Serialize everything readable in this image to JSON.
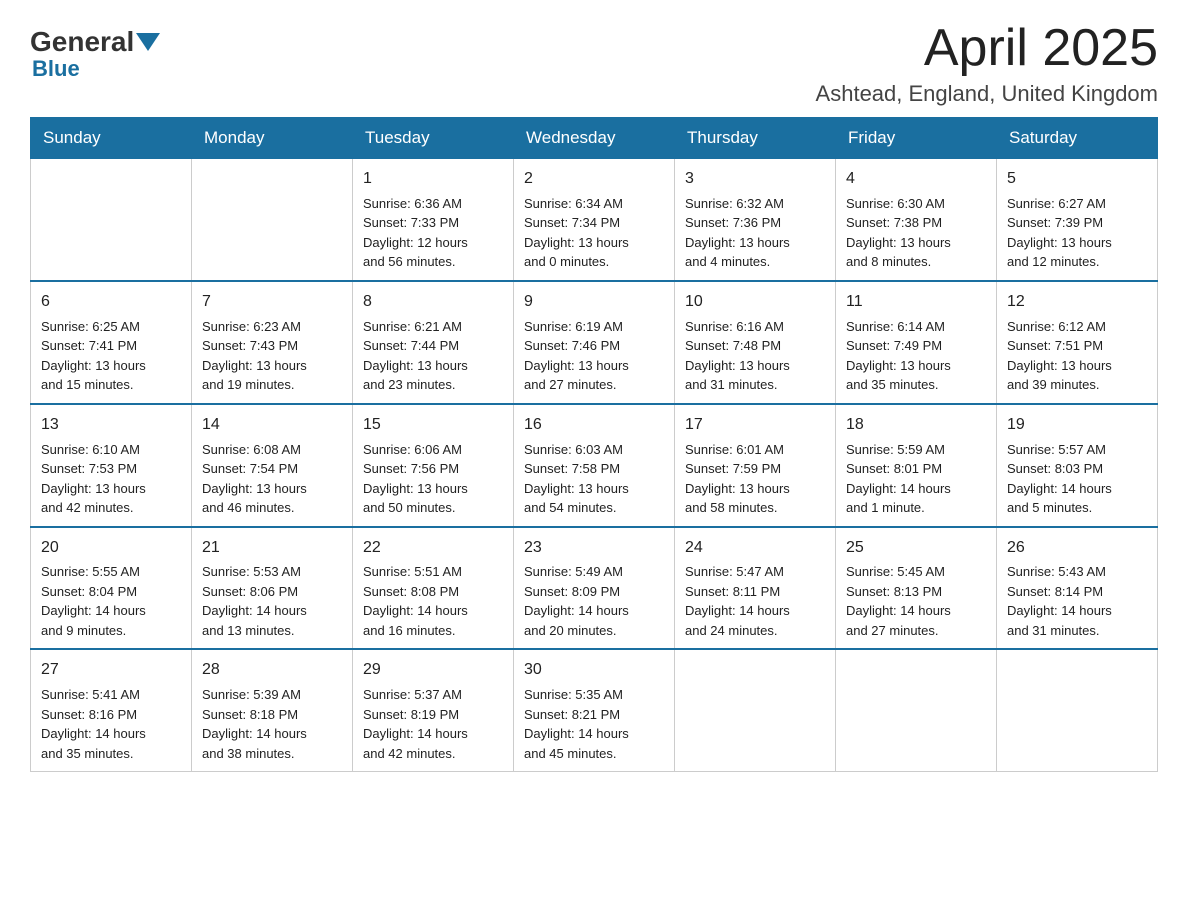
{
  "logo": {
    "general": "General",
    "blue": "Blue"
  },
  "title": "April 2025",
  "subtitle": "Ashtead, England, United Kingdom",
  "weekdays": [
    "Sunday",
    "Monday",
    "Tuesday",
    "Wednesday",
    "Thursday",
    "Friday",
    "Saturday"
  ],
  "weeks": [
    [
      {
        "day": "",
        "info": ""
      },
      {
        "day": "",
        "info": ""
      },
      {
        "day": "1",
        "info": "Sunrise: 6:36 AM\nSunset: 7:33 PM\nDaylight: 12 hours\nand 56 minutes."
      },
      {
        "day": "2",
        "info": "Sunrise: 6:34 AM\nSunset: 7:34 PM\nDaylight: 13 hours\nand 0 minutes."
      },
      {
        "day": "3",
        "info": "Sunrise: 6:32 AM\nSunset: 7:36 PM\nDaylight: 13 hours\nand 4 minutes."
      },
      {
        "day": "4",
        "info": "Sunrise: 6:30 AM\nSunset: 7:38 PM\nDaylight: 13 hours\nand 8 minutes."
      },
      {
        "day": "5",
        "info": "Sunrise: 6:27 AM\nSunset: 7:39 PM\nDaylight: 13 hours\nand 12 minutes."
      }
    ],
    [
      {
        "day": "6",
        "info": "Sunrise: 6:25 AM\nSunset: 7:41 PM\nDaylight: 13 hours\nand 15 minutes."
      },
      {
        "day": "7",
        "info": "Sunrise: 6:23 AM\nSunset: 7:43 PM\nDaylight: 13 hours\nand 19 minutes."
      },
      {
        "day": "8",
        "info": "Sunrise: 6:21 AM\nSunset: 7:44 PM\nDaylight: 13 hours\nand 23 minutes."
      },
      {
        "day": "9",
        "info": "Sunrise: 6:19 AM\nSunset: 7:46 PM\nDaylight: 13 hours\nand 27 minutes."
      },
      {
        "day": "10",
        "info": "Sunrise: 6:16 AM\nSunset: 7:48 PM\nDaylight: 13 hours\nand 31 minutes."
      },
      {
        "day": "11",
        "info": "Sunrise: 6:14 AM\nSunset: 7:49 PM\nDaylight: 13 hours\nand 35 minutes."
      },
      {
        "day": "12",
        "info": "Sunrise: 6:12 AM\nSunset: 7:51 PM\nDaylight: 13 hours\nand 39 minutes."
      }
    ],
    [
      {
        "day": "13",
        "info": "Sunrise: 6:10 AM\nSunset: 7:53 PM\nDaylight: 13 hours\nand 42 minutes."
      },
      {
        "day": "14",
        "info": "Sunrise: 6:08 AM\nSunset: 7:54 PM\nDaylight: 13 hours\nand 46 minutes."
      },
      {
        "day": "15",
        "info": "Sunrise: 6:06 AM\nSunset: 7:56 PM\nDaylight: 13 hours\nand 50 minutes."
      },
      {
        "day": "16",
        "info": "Sunrise: 6:03 AM\nSunset: 7:58 PM\nDaylight: 13 hours\nand 54 minutes."
      },
      {
        "day": "17",
        "info": "Sunrise: 6:01 AM\nSunset: 7:59 PM\nDaylight: 13 hours\nand 58 minutes."
      },
      {
        "day": "18",
        "info": "Sunrise: 5:59 AM\nSunset: 8:01 PM\nDaylight: 14 hours\nand 1 minute."
      },
      {
        "day": "19",
        "info": "Sunrise: 5:57 AM\nSunset: 8:03 PM\nDaylight: 14 hours\nand 5 minutes."
      }
    ],
    [
      {
        "day": "20",
        "info": "Sunrise: 5:55 AM\nSunset: 8:04 PM\nDaylight: 14 hours\nand 9 minutes."
      },
      {
        "day": "21",
        "info": "Sunrise: 5:53 AM\nSunset: 8:06 PM\nDaylight: 14 hours\nand 13 minutes."
      },
      {
        "day": "22",
        "info": "Sunrise: 5:51 AM\nSunset: 8:08 PM\nDaylight: 14 hours\nand 16 minutes."
      },
      {
        "day": "23",
        "info": "Sunrise: 5:49 AM\nSunset: 8:09 PM\nDaylight: 14 hours\nand 20 minutes."
      },
      {
        "day": "24",
        "info": "Sunrise: 5:47 AM\nSunset: 8:11 PM\nDaylight: 14 hours\nand 24 minutes."
      },
      {
        "day": "25",
        "info": "Sunrise: 5:45 AM\nSunset: 8:13 PM\nDaylight: 14 hours\nand 27 minutes."
      },
      {
        "day": "26",
        "info": "Sunrise: 5:43 AM\nSunset: 8:14 PM\nDaylight: 14 hours\nand 31 minutes."
      }
    ],
    [
      {
        "day": "27",
        "info": "Sunrise: 5:41 AM\nSunset: 8:16 PM\nDaylight: 14 hours\nand 35 minutes."
      },
      {
        "day": "28",
        "info": "Sunrise: 5:39 AM\nSunset: 8:18 PM\nDaylight: 14 hours\nand 38 minutes."
      },
      {
        "day": "29",
        "info": "Sunrise: 5:37 AM\nSunset: 8:19 PM\nDaylight: 14 hours\nand 42 minutes."
      },
      {
        "day": "30",
        "info": "Sunrise: 5:35 AM\nSunset: 8:21 PM\nDaylight: 14 hours\nand 45 minutes."
      },
      {
        "day": "",
        "info": ""
      },
      {
        "day": "",
        "info": ""
      },
      {
        "day": "",
        "info": ""
      }
    ]
  ]
}
